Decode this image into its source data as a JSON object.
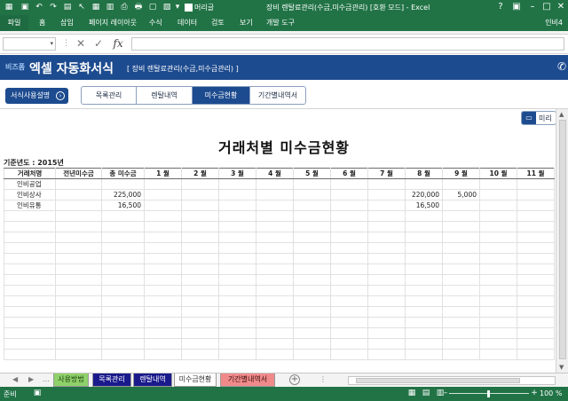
{
  "window": {
    "title": "장비 렌탈료관리(수금,미수금관리) [호환 모드] - Excel",
    "autosave_label": "머리글",
    "user": "인비4"
  },
  "ribbon": {
    "file": "파일",
    "tabs": [
      "홈",
      "삽입",
      "페이지 레이아웃",
      "수식",
      "데이터",
      "검토",
      "보기",
      "개발 도구"
    ]
  },
  "formula_bar": {
    "fx": "fx",
    "name_box": "",
    "formula": ""
  },
  "banner": {
    "brand": "비즈폼",
    "title": "엑셀 자동화서식",
    "subtitle": "[ 장비 렌탈료관리(수금,미수금관리) ]"
  },
  "controls": {
    "guide_button": "서식사용설명",
    "nav_tabs": [
      {
        "label": "목록관리",
        "active": false
      },
      {
        "label": "렌탈내역",
        "active": false
      },
      {
        "label": "미수금현황",
        "active": true
      },
      {
        "label": "기간별내역서",
        "active": false
      }
    ],
    "preview_button": "미리"
  },
  "report": {
    "title": "거래처별 미수금현황",
    "year_label": "기준년도 : 2015년",
    "columns": [
      "거래처명",
      "전년미수금",
      "총 미수금",
      "1 월",
      "2 월",
      "3 월",
      "4 월",
      "5 월",
      "6 월",
      "7 월",
      "8 월",
      "9 월",
      "10 월",
      "11 월"
    ],
    "rows": [
      [
        "인비공업",
        "",
        "",
        "",
        "",
        "",
        "",
        "",
        "",
        "",
        "",
        "",
        "",
        ""
      ],
      [
        "인비상사",
        "",
        "225,000",
        "",
        "",
        "",
        "",
        "",
        "",
        "",
        "220,000",
        "5,000",
        "",
        ""
      ],
      [
        "인비유통",
        "",
        "16,500",
        "",
        "",
        "",
        "",
        "",
        "",
        "",
        "16,500",
        "",
        "",
        ""
      ],
      [
        "",
        "",
        "",
        "",
        "",
        "",
        "",
        "",
        "",
        "",
        "",
        "",
        "",
        ""
      ],
      [
        "",
        "",
        "",
        "",
        "",
        "",
        "",
        "",
        "",
        "",
        "",
        "",
        "",
        ""
      ],
      [
        "",
        "",
        "",
        "",
        "",
        "",
        "",
        "",
        "",
        "",
        "",
        "",
        "",
        ""
      ],
      [
        "",
        "",
        "",
        "",
        "",
        "",
        "",
        "",
        "",
        "",
        "",
        "",
        "",
        ""
      ],
      [
        "",
        "",
        "",
        "",
        "",
        "",
        "",
        "",
        "",
        "",
        "",
        "",
        "",
        ""
      ],
      [
        "",
        "",
        "",
        "",
        "",
        "",
        "",
        "",
        "",
        "",
        "",
        "",
        "",
        ""
      ],
      [
        "",
        "",
        "",
        "",
        "",
        "",
        "",
        "",
        "",
        "",
        "",
        "",
        "",
        ""
      ],
      [
        "",
        "",
        "",
        "",
        "",
        "",
        "",
        "",
        "",
        "",
        "",
        "",
        "",
        ""
      ],
      [
        "",
        "",
        "",
        "",
        "",
        "",
        "",
        "",
        "",
        "",
        "",
        "",
        "",
        ""
      ],
      [
        "",
        "",
        "",
        "",
        "",
        "",
        "",
        "",
        "",
        "",
        "",
        "",
        "",
        ""
      ],
      [
        "",
        "",
        "",
        "",
        "",
        "",
        "",
        "",
        "",
        "",
        "",
        "",
        "",
        ""
      ],
      [
        "",
        "",
        "",
        "",
        "",
        "",
        "",
        "",
        "",
        "",
        "",
        "",
        "",
        ""
      ],
      [
        "",
        "",
        "",
        "",
        "",
        "",
        "",
        "",
        "",
        "",
        "",
        "",
        "",
        ""
      ],
      [
        "",
        "",
        "",
        "",
        "",
        "",
        "",
        "",
        "",
        "",
        "",
        "",
        "",
        ""
      ]
    ]
  },
  "sheet_tabs": [
    {
      "label": "사용방법",
      "bg": "#8fd16a",
      "fg": "#1b3d0e"
    },
    {
      "label": "목록관리",
      "bg": "#1a1a8c",
      "fg": "#ffffff"
    },
    {
      "label": "렌탈내역",
      "bg": "#1a1a8c",
      "fg": "#ffffff"
    },
    {
      "label": "미수금현황",
      "bg": "#ffffff",
      "fg": "#333333",
      "active": true
    },
    {
      "label": "기간별내역서",
      "bg": "#f08a8a",
      "fg": "#3a0f0f"
    }
  ],
  "status": {
    "ready": "준비",
    "zoom": "100 %"
  },
  "colors": {
    "excel_green": "#217346",
    "banner_blue": "#1d4b8f"
  }
}
